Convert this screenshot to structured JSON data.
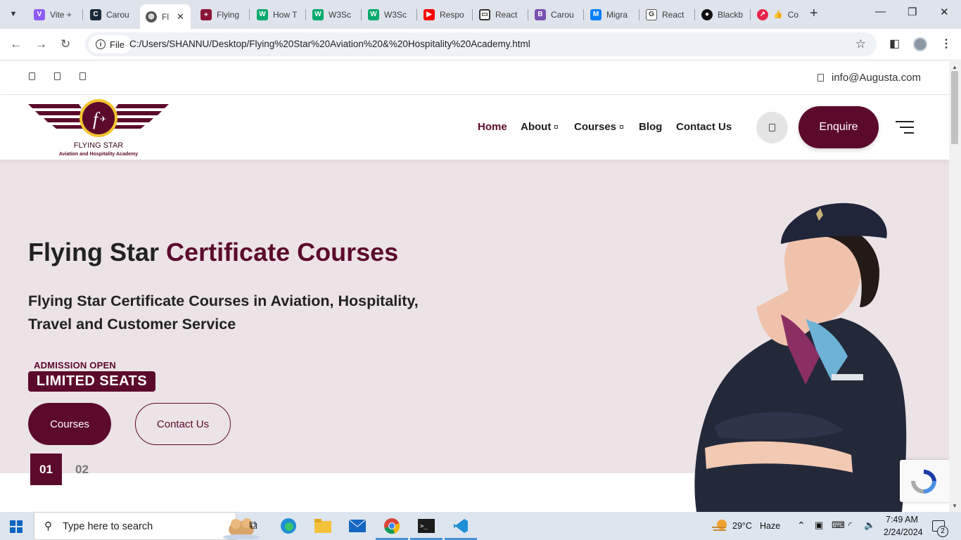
{
  "browser": {
    "tabs": [
      {
        "title": "Vite +",
        "favicon": "vite-icon",
        "color": "#8f5cf6"
      },
      {
        "title": "Carou",
        "favicon": "codepen-icon",
        "color": "#1b2a3a"
      },
      {
        "title": "Fl",
        "favicon": "globe-icon",
        "color": "#444",
        "active": true
      },
      {
        "title": "Flying",
        "favicon": "flying-star-icon",
        "color": "#8a1538"
      },
      {
        "title": "How T",
        "favicon": "w3schools-icon",
        "color": "#04aa6d"
      },
      {
        "title": "W3Sc",
        "favicon": "w3schools-icon",
        "color": "#04aa6d"
      },
      {
        "title": "W3Sc",
        "favicon": "w3schools-icon",
        "color": "#04aa6d"
      },
      {
        "title": "Respo",
        "favicon": "youtube-icon",
        "color": "#ff0000"
      },
      {
        "title": "React",
        "favicon": "react-tab-icon",
        "color": "#333"
      },
      {
        "title": "Carou",
        "favicon": "bootstrap-icon",
        "color": "#7952b3"
      },
      {
        "title": "Migra",
        "favicon": "mui-icon",
        "color": "#007fff"
      },
      {
        "title": "React",
        "favicon": "code-icon",
        "color": "#555"
      },
      {
        "title": "Blackb",
        "favicon": "blackbox-icon",
        "color": "#111"
      },
      {
        "title": "Co",
        "favicon": "compass-icon",
        "color": "#e8234b"
      }
    ],
    "url": "C:/Users/SHANNU/Desktop/Flying%20Star%20Aviation%20&%20Hospitality%20Academy.html",
    "file_label": "File"
  },
  "page": {
    "email": "info@Augusta.com",
    "logo": {
      "line1": "FLYING STAR",
      "line2": "Aviation and Hospitality Academy"
    },
    "nav": [
      "Home",
      "About",
      "Courses",
      "Blog",
      "Contact Us"
    ],
    "enquire": "Enquire",
    "hero": {
      "title_plain": "Flying Star",
      "title_accent": "Certificate Courses",
      "subtitle": "Flying Star Certificate Courses in Aviation, Hospitality, Travel and Customer Service",
      "badge_top": "ADMISSION OPEN",
      "badge_main": "LIMITED SEATS",
      "btn_primary": "Courses",
      "btn_secondary": "Contact Us"
    },
    "slides": [
      "01",
      "02"
    ],
    "colors": {
      "brand": "#5c0a2c",
      "hero_bg": "#ece3e7"
    }
  },
  "taskbar": {
    "search_placeholder": "Type here to search",
    "weather_temp": "29°C",
    "weather_desc": "Haze",
    "time": "7:49 AM",
    "date": "2/24/2024",
    "notifications": "2"
  }
}
